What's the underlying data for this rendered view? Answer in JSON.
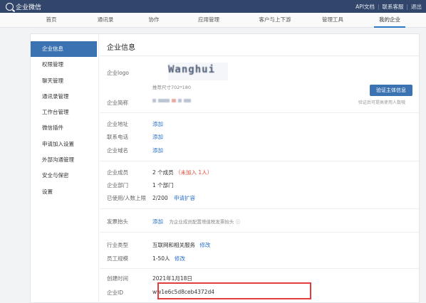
{
  "app": {
    "title": "企业微信"
  },
  "topLinks": [
    "API文档",
    "联系客服",
    "退出"
  ],
  "nav": {
    "items": [
      {
        "label": "首页"
      },
      {
        "label": "通讯录"
      },
      {
        "label": "协作"
      },
      {
        "label": "应用管理"
      },
      {
        "label": "客户与上下游"
      },
      {
        "label": "管理工具"
      },
      {
        "label": "我的企业"
      }
    ],
    "active": "我的企业"
  },
  "sidebar": {
    "items": [
      {
        "label": "企业信息"
      },
      {
        "label": "权限管理"
      },
      {
        "label": "聊天管理"
      },
      {
        "label": "通讯录管理"
      },
      {
        "label": "工作台管理"
      },
      {
        "label": "微信插件"
      },
      {
        "label": "申请加入设置"
      },
      {
        "label": "外部沟通管理"
      },
      {
        "label": "安全与保密"
      },
      {
        "label": "设置"
      }
    ]
  },
  "page": {
    "title": "企业信息",
    "logoLabel": "企业logo",
    "logoText": "Wanghui",
    "logoSizeHint": "推荐尺寸702*180",
    "nameLabel": "企业简称",
    "verifyButton": "验证主体信息",
    "verifyTip": "验证后可提高使用人数哦",
    "addressLabel": "企业地址",
    "addressAction": "添加",
    "phoneLabel": "联系电话",
    "phoneAction": "添加",
    "domainLabel": "企业域名",
    "domainAction": "添加",
    "membersLabel": "企业成员",
    "membersValue": "2 个成员",
    "membersPending": "（未加入 1人）",
    "deptLabel": "企业部门",
    "deptValue": "1 个部门",
    "usageLabel": "已使用/人数上限",
    "usageValue": "2/200",
    "usageAction": "申请扩容",
    "invoiceLabel": "发票抬头",
    "invoiceAction": "添加",
    "invoiceHint": "为企业成员配置增值税发票抬头",
    "industryLabel": "行业类型",
    "industryValue": "互联网和相关服务",
    "industryAction": "修改",
    "staffLabel": "员工规模",
    "staffValue": "1-50人",
    "staffAction": "修改",
    "createdLabel": "创建时间",
    "createdValue": "2021年1月18日",
    "corpIdLabel": "企业ID",
    "corpIdValue": "ww1e6c5d8ceb4372d4"
  },
  "colors": {
    "topbar": "#31466a",
    "accent": "#3b73b2",
    "link": "#2a6fc9",
    "highlight": "#e23d3d"
  }
}
